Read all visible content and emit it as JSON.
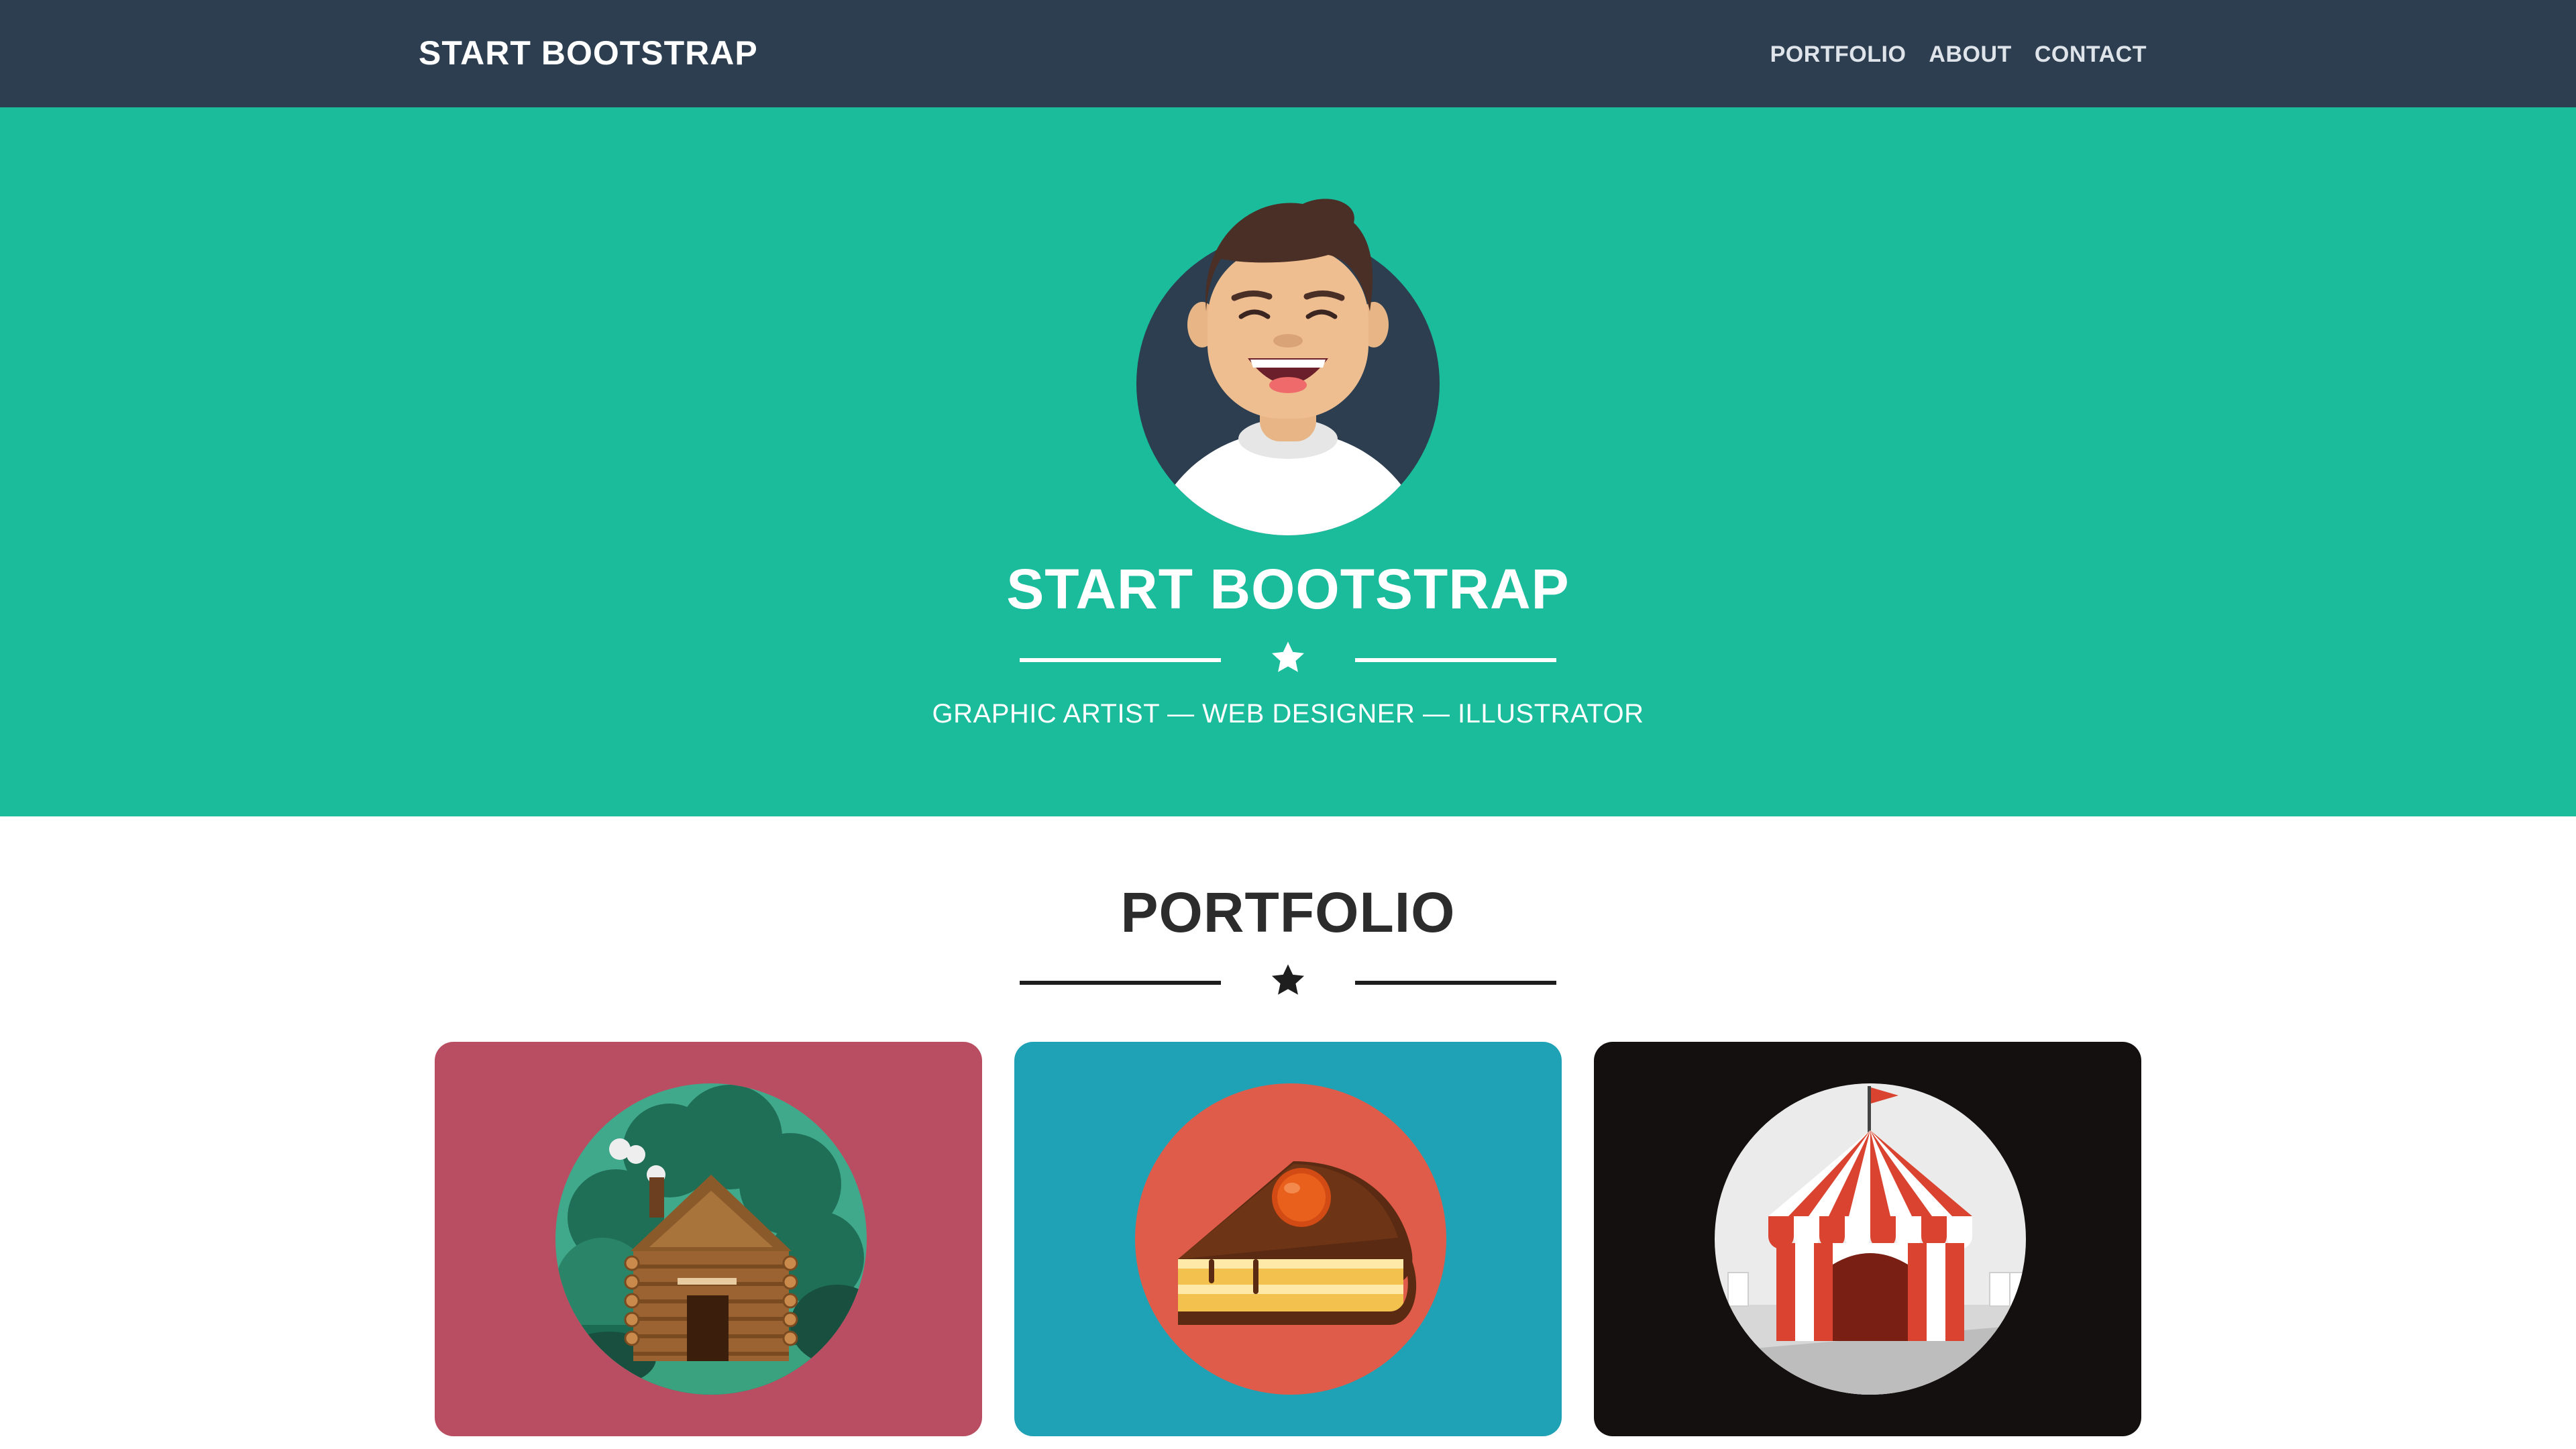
{
  "navbar": {
    "brand": "START BOOTSTRAP",
    "links": [
      "PORTFOLIO",
      "ABOUT",
      "CONTACT"
    ]
  },
  "hero": {
    "title": "START BOOTSTRAP",
    "subtitle": "GRAPHIC ARTIST — WEB DESIGNER — ILLUSTRATOR"
  },
  "portfolio": {
    "title": "PORTFOLIO",
    "items": [
      {
        "icon": "cabin-icon",
        "background": "#b94e62"
      },
      {
        "icon": "cake-icon",
        "background": "#1fa2b6"
      },
      {
        "icon": "circus-tent-icon",
        "background": "#141010"
      }
    ]
  },
  "colors": {
    "navbar": "#2c3e50",
    "hero": "#1abc9c",
    "text_dark": "#2c2c2c"
  }
}
